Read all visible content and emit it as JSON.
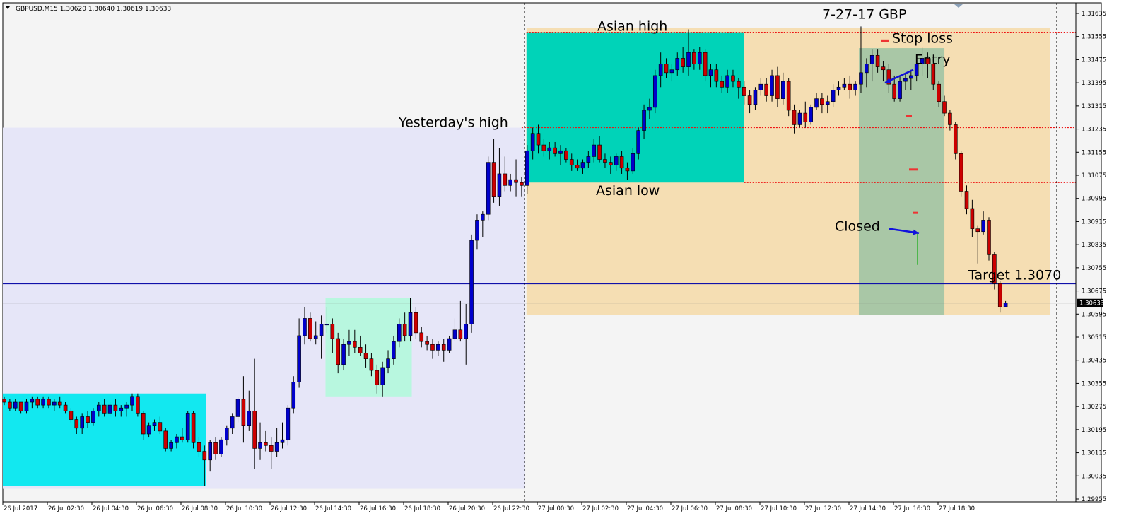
{
  "header": {
    "symbol_line": "GBPUSD,M15  1.30620 1.30640 1.30619 1.30633"
  },
  "colors": {
    "background": "#f4f4f4",
    "bull_candle": "#0000cc",
    "bear_candle": "#cc0000",
    "yesterday_zone": "#e6e6f8",
    "asian_box_prev": "#12e8f0",
    "mid_box": "#b8f7df",
    "today_zone": "#f5deb3",
    "asian_box_today": "#00d3b8",
    "trade_box": "#a9c7a6",
    "target_line": "#1010aa",
    "level_line": "#ee1111"
  },
  "chart_data": {
    "type": "candlestick",
    "title": "7-27-17  GBP",
    "symbol": "GBPUSD",
    "timeframe": "M15",
    "ylim": [
      1.2995,
      1.3168
    ],
    "y_ticks": [
      "1.31635",
      "1.31555",
      "1.31475",
      "1.31395",
      "1.31315",
      "1.31235",
      "1.31155",
      "1.31075",
      "1.30995",
      "1.30915",
      "1.30835",
      "1.30755",
      "1.30675",
      "1.30595",
      "1.30515",
      "1.30435",
      "1.30355",
      "1.30275",
      "1.30195",
      "1.30115",
      "1.30035",
      "1.29955"
    ],
    "x_ticks": [
      "26 Jul 2017",
      "26 Jul 02:30",
      "26 Jul 04:30",
      "26 Jul 06:30",
      "26 Jul 08:30",
      "26 Jul 10:30",
      "26 Jul 12:30",
      "26 Jul 14:30",
      "26 Jul 16:30",
      "26 Jul 18:30",
      "26 Jul 20:30",
      "26 Jul 22:30",
      "27 Jul 00:30",
      "27 Jul 02:30",
      "27 Jul 04:30",
      "27 Jul 06:30",
      "27 Jul 08:30",
      "27 Jul 10:30",
      "27 Jul 12:30",
      "27 Jul 14:30",
      "27 Jul 16:30",
      "27 Jul 18:30"
    ],
    "current_price": "1.30633",
    "levels": {
      "asian_high": 1.3157,
      "yesterdays_high": 1.3124,
      "asian_low": 1.3105,
      "target": 1.307,
      "current": 1.30633
    },
    "annotations": {
      "title": "7-27-17  GBP",
      "asian_high": "Asian high",
      "asian_low": "Asian low",
      "yesterdays_high": "Yesterday's high",
      "stop_loss": "Stop loss",
      "entry": "Entry",
      "closed": "Closed",
      "target": "Target  1.3070"
    },
    "candles": [
      [
        1.303,
        1.3031,
        1.3028,
        1.3029
      ],
      [
        1.3029,
        1.303,
        1.3026,
        1.3027
      ],
      [
        1.3027,
        1.303,
        1.3026,
        1.3029
      ],
      [
        1.3029,
        1.3029,
        1.3025,
        1.3026
      ],
      [
        1.3026,
        1.303,
        1.3025,
        1.3029
      ],
      [
        1.3029,
        1.3031,
        1.3027,
        1.303
      ],
      [
        1.303,
        1.3031,
        1.3027,
        1.3028
      ],
      [
        1.3028,
        1.3031,
        1.3027,
        1.303
      ],
      [
        1.303,
        1.3031,
        1.3027,
        1.3028
      ],
      [
        1.3028,
        1.303,
        1.3026,
        1.3029
      ],
      [
        1.3029,
        1.3031,
        1.3027,
        1.3028
      ],
      [
        1.3028,
        1.3029,
        1.3025,
        1.3026
      ],
      [
        1.3026,
        1.3027,
        1.3022,
        1.3023
      ],
      [
        1.3023,
        1.3024,
        1.3018,
        1.302
      ],
      [
        1.302,
        1.3025,
        1.3018,
        1.3024
      ],
      [
        1.3024,
        1.3026,
        1.302,
        1.3022
      ],
      [
        1.3022,
        1.3027,
        1.3021,
        1.3026
      ],
      [
        1.3026,
        1.3029,
        1.3024,
        1.3028
      ],
      [
        1.3028,
        1.303,
        1.3024,
        1.3025
      ],
      [
        1.3025,
        1.3029,
        1.3024,
        1.3028
      ],
      [
        1.3028,
        1.303,
        1.3024,
        1.3026
      ],
      [
        1.3026,
        1.3028,
        1.3024,
        1.3027
      ],
      [
        1.3027,
        1.3029,
        1.3024,
        1.3028
      ],
      [
        1.3028,
        1.3032,
        1.3026,
        1.3031
      ],
      [
        1.3031,
        1.3032,
        1.3024,
        1.3025
      ],
      [
        1.3025,
        1.3026,
        1.3016,
        1.3018
      ],
      [
        1.3018,
        1.3022,
        1.3017,
        1.3021
      ],
      [
        1.3021,
        1.3023,
        1.3019,
        1.3022
      ],
      [
        1.3022,
        1.3024,
        1.3018,
        1.3019
      ],
      [
        1.3019,
        1.302,
        1.3012,
        1.3013
      ],
      [
        1.3013,
        1.3016,
        1.3012,
        1.3015
      ],
      [
        1.3015,
        1.3018,
        1.3013,
        1.3017
      ],
      [
        1.3017,
        1.302,
        1.3015,
        1.3016
      ],
      [
        1.3016,
        1.3026,
        1.3015,
        1.3025
      ],
      [
        1.3025,
        1.3026,
        1.3013,
        1.3015
      ],
      [
        1.3015,
        1.3017,
        1.301,
        1.3012
      ],
      [
        1.3012,
        1.3014,
        1.3,
        1.3009
      ],
      [
        1.3009,
        1.3016,
        1.3005,
        1.3015
      ],
      [
        1.3015,
        1.3017,
        1.3009,
        1.3011
      ],
      [
        1.3011,
        1.3017,
        1.301,
        1.3016
      ],
      [
        1.3016,
        1.3021,
        1.3014,
        1.302
      ],
      [
        1.302,
        1.3025,
        1.3018,
        1.3024
      ],
      [
        1.3024,
        1.3031,
        1.3022,
        1.303
      ],
      [
        1.303,
        1.3038,
        1.3015,
        1.3021
      ],
      [
        1.3021,
        1.3033,
        1.3019,
        1.3026
      ],
      [
        1.3026,
        1.3044,
        1.3006,
        1.3013
      ],
      [
        1.3013,
        1.3022,
        1.3009,
        1.3015
      ],
      [
        1.3015,
        1.3019,
        1.3012,
        1.3014
      ],
      [
        1.3014,
        1.3017,
        1.3006,
        1.3012
      ],
      [
        1.3012,
        1.302,
        1.301,
        1.3015
      ],
      [
        1.3015,
        1.3022,
        1.3013,
        1.3016
      ],
      [
        1.3016,
        1.3028,
        1.3014,
        1.3027
      ],
      [
        1.3027,
        1.3038,
        1.3025,
        1.3036
      ],
      [
        1.3036,
        1.3058,
        1.3034,
        1.3052
      ],
      [
        1.3052,
        1.3062,
        1.3049,
        1.3058
      ],
      [
        1.3058,
        1.306,
        1.305,
        1.3051
      ],
      [
        1.3051,
        1.3057,
        1.3049,
        1.3052
      ],
      [
        1.3052,
        1.3059,
        1.3044,
        1.3056
      ],
      [
        1.3056,
        1.3062,
        1.3053,
        1.3056
      ],
      [
        1.3056,
        1.3058,
        1.3046,
        1.3051
      ],
      [
        1.3051,
        1.3053,
        1.3039,
        1.3042
      ],
      [
        1.3042,
        1.3051,
        1.304,
        1.3049
      ],
      [
        1.3049,
        1.3054,
        1.3045,
        1.305
      ],
      [
        1.305,
        1.3054,
        1.3046,
        1.3048
      ],
      [
        1.3048,
        1.3052,
        1.3045,
        1.3046
      ],
      [
        1.3046,
        1.3049,
        1.3041,
        1.3044
      ],
      [
        1.3044,
        1.3046,
        1.3038,
        1.304
      ],
      [
        1.304,
        1.3042,
        1.3032,
        1.3035
      ],
      [
        1.3035,
        1.3043,
        1.3031,
        1.3041
      ],
      [
        1.3041,
        1.3047,
        1.3039,
        1.3044
      ],
      [
        1.3044,
        1.3052,
        1.3042,
        1.305
      ],
      [
        1.305,
        1.3058,
        1.3048,
        1.3056
      ],
      [
        1.3056,
        1.306,
        1.305,
        1.3052
      ],
      [
        1.3052,
        1.3065,
        1.305,
        1.306
      ],
      [
        1.306,
        1.3062,
        1.3051,
        1.3053
      ],
      [
        1.3053,
        1.3055,
        1.3048,
        1.305
      ],
      [
        1.305,
        1.3052,
        1.3047,
        1.3049
      ],
      [
        1.3049,
        1.3051,
        1.3044,
        1.3047
      ],
      [
        1.3047,
        1.305,
        1.3045,
        1.3049
      ],
      [
        1.3049,
        1.3051,
        1.3043,
        1.3047
      ],
      [
        1.3047,
        1.3052,
        1.3046,
        1.3051
      ],
      [
        1.3051,
        1.3058,
        1.305,
        1.3054
      ],
      [
        1.3054,
        1.3064,
        1.305,
        1.3051
      ],
      [
        1.3051,
        1.3063,
        1.3042,
        1.3056
      ],
      [
        1.3056,
        1.3087,
        1.3053,
        1.3085
      ],
      [
        1.3085,
        1.3094,
        1.3082,
        1.3092
      ],
      [
        1.3092,
        1.3095,
        1.3086,
        1.3094
      ],
      [
        1.3094,
        1.3114,
        1.3092,
        1.3112
      ],
      [
        1.3112,
        1.312,
        1.3098,
        1.31
      ],
      [
        1.31,
        1.3117,
        1.3097,
        1.3108
      ],
      [
        1.3108,
        1.3114,
        1.3102,
        1.3104
      ],
      [
        1.3104,
        1.3108,
        1.3102,
        1.3106
      ],
      [
        1.3106,
        1.3113,
        1.31,
        1.3105
      ],
      [
        1.3105,
        1.3107,
        1.31,
        1.3104
      ],
      [
        1.3104,
        1.3118,
        1.3101,
        1.3116
      ],
      [
        1.3116,
        1.3124,
        1.3113,
        1.3122
      ],
      [
        1.3122,
        1.3125,
        1.3115,
        1.3118
      ],
      [
        1.3118,
        1.312,
        1.3114,
        1.3116
      ],
      [
        1.3116,
        1.3119,
        1.3113,
        1.3117
      ],
      [
        1.3117,
        1.3119,
        1.3114,
        1.3115
      ],
      [
        1.3115,
        1.3118,
        1.3111,
        1.3116
      ],
      [
        1.3116,
        1.3117,
        1.3112,
        1.3113
      ],
      [
        1.3113,
        1.3115,
        1.3109,
        1.3111
      ],
      [
        1.3111,
        1.3113,
        1.3109,
        1.311
      ],
      [
        1.311,
        1.3113,
        1.3108,
        1.3112
      ],
      [
        1.3112,
        1.3116,
        1.311,
        1.3114
      ],
      [
        1.3114,
        1.312,
        1.3112,
        1.3118
      ],
      [
        1.3118,
        1.3121,
        1.3112,
        1.3113
      ],
      [
        1.3113,
        1.3115,
        1.311,
        1.3112
      ],
      [
        1.3112,
        1.3114,
        1.3108,
        1.3111
      ],
      [
        1.3111,
        1.3115,
        1.3109,
        1.3114
      ],
      [
        1.3114,
        1.3116,
        1.3108,
        1.311
      ],
      [
        1.311,
        1.3112,
        1.3106,
        1.3109
      ],
      [
        1.3109,
        1.3117,
        1.3108,
        1.3115
      ],
      [
        1.3115,
        1.3124,
        1.3113,
        1.3123
      ],
      [
        1.3123,
        1.3132,
        1.312,
        1.313
      ],
      [
        1.313,
        1.3134,
        1.3127,
        1.3131
      ],
      [
        1.3131,
        1.3144,
        1.3129,
        1.3142
      ],
      [
        1.3142,
        1.315,
        1.3138,
        1.3146
      ],
      [
        1.3146,
        1.3148,
        1.3141,
        1.3143
      ],
      [
        1.3143,
        1.3146,
        1.314,
        1.3144
      ],
      [
        1.3144,
        1.315,
        1.3142,
        1.3148
      ],
      [
        1.3148,
        1.3152,
        1.3143,
        1.3145
      ],
      [
        1.3145,
        1.3158,
        1.3142,
        1.315
      ],
      [
        1.315,
        1.3151,
        1.3144,
        1.3146
      ],
      [
        1.3146,
        1.3152,
        1.3144,
        1.315
      ],
      [
        1.315,
        1.3151,
        1.314,
        1.3142
      ],
      [
        1.3142,
        1.3146,
        1.3138,
        1.3144
      ],
      [
        1.3144,
        1.3146,
        1.3138,
        1.314
      ],
      [
        1.314,
        1.3142,
        1.3136,
        1.3138
      ],
      [
        1.3138,
        1.3144,
        1.3136,
        1.3142
      ],
      [
        1.3142,
        1.3144,
        1.3138,
        1.314
      ],
      [
        1.314,
        1.3141,
        1.3134,
        1.3138
      ],
      [
        1.3138,
        1.314,
        1.3132,
        1.3135
      ],
      [
        1.3135,
        1.3137,
        1.3129,
        1.3132
      ],
      [
        1.3132,
        1.3138,
        1.313,
        1.3137
      ],
      [
        1.3137,
        1.3141,
        1.3135,
        1.3139
      ],
      [
        1.3139,
        1.3141,
        1.3133,
        1.3135
      ],
      [
        1.3135,
        1.3144,
        1.3133,
        1.3142
      ],
      [
        1.3142,
        1.3145,
        1.3131,
        1.3134
      ],
      [
        1.3134,
        1.3143,
        1.3132,
        1.314
      ],
      [
        1.314,
        1.3141,
        1.3128,
        1.313
      ],
      [
        1.313,
        1.3132,
        1.3122,
        1.3125
      ],
      [
        1.3125,
        1.313,
        1.3124,
        1.3129
      ],
      [
        1.3129,
        1.3133,
        1.3124,
        1.3126
      ],
      [
        1.3126,
        1.3132,
        1.3125,
        1.3131
      ],
      [
        1.3131,
        1.3136,
        1.313,
        1.3134
      ],
      [
        1.3134,
        1.3136,
        1.3129,
        1.3132
      ],
      [
        1.3132,
        1.3135,
        1.3129,
        1.3133
      ],
      [
        1.3133,
        1.3139,
        1.3131,
        1.3137
      ],
      [
        1.3137,
        1.314,
        1.3135,
        1.3138
      ],
      [
        1.3138,
        1.3141,
        1.3137,
        1.3139
      ],
      [
        1.3139,
        1.3142,
        1.3134,
        1.3137
      ],
      [
        1.3137,
        1.314,
        1.3135,
        1.3139
      ],
      [
        1.3139,
        1.3159,
        1.3136,
        1.3143
      ],
      [
        1.3143,
        1.3148,
        1.3138,
        1.3146
      ],
      [
        1.3146,
        1.3151,
        1.314,
        1.3149
      ],
      [
        1.3149,
        1.3151,
        1.3143,
        1.3145
      ],
      [
        1.3145,
        1.3147,
        1.314,
        1.3144
      ],
      [
        1.3144,
        1.3146,
        1.3136,
        1.3139
      ],
      [
        1.3139,
        1.3142,
        1.3133,
        1.3134
      ],
      [
        1.3134,
        1.3142,
        1.3133,
        1.314
      ],
      [
        1.314,
        1.3143,
        1.3137,
        1.3141
      ],
      [
        1.3141,
        1.3144,
        1.3137,
        1.3142
      ],
      [
        1.3142,
        1.3147,
        1.314,
        1.3146
      ],
      [
        1.3146,
        1.3152,
        1.3142,
        1.3148
      ],
      [
        1.3148,
        1.315,
        1.3141,
        1.3146
      ],
      [
        1.3146,
        1.3148,
        1.3137,
        1.3139
      ],
      [
        1.3139,
        1.314,
        1.3131,
        1.3133
      ],
      [
        1.3133,
        1.3135,
        1.3128,
        1.3129
      ],
      [
        1.3129,
        1.313,
        1.3123,
        1.3125
      ],
      [
        1.3125,
        1.3126,
        1.3113,
        1.3115
      ],
      [
        1.3115,
        1.3116,
        1.31,
        1.3102
      ],
      [
        1.3102,
        1.3104,
        1.3094,
        1.3096
      ],
      [
        1.3096,
        1.3099,
        1.3086,
        1.3089
      ],
      [
        1.3089,
        1.309,
        1.3077,
        1.3088
      ],
      [
        1.3088,
        1.3095,
        1.3087,
        1.3092
      ],
      [
        1.3092,
        1.3093,
        1.3078,
        1.308
      ],
      [
        1.308,
        1.3081,
        1.3068,
        1.307
      ],
      [
        1.307,
        1.3071,
        1.306,
        1.3062
      ],
      [
        1.3062,
        1.3064,
        1.30619,
        1.30633
      ]
    ]
  }
}
